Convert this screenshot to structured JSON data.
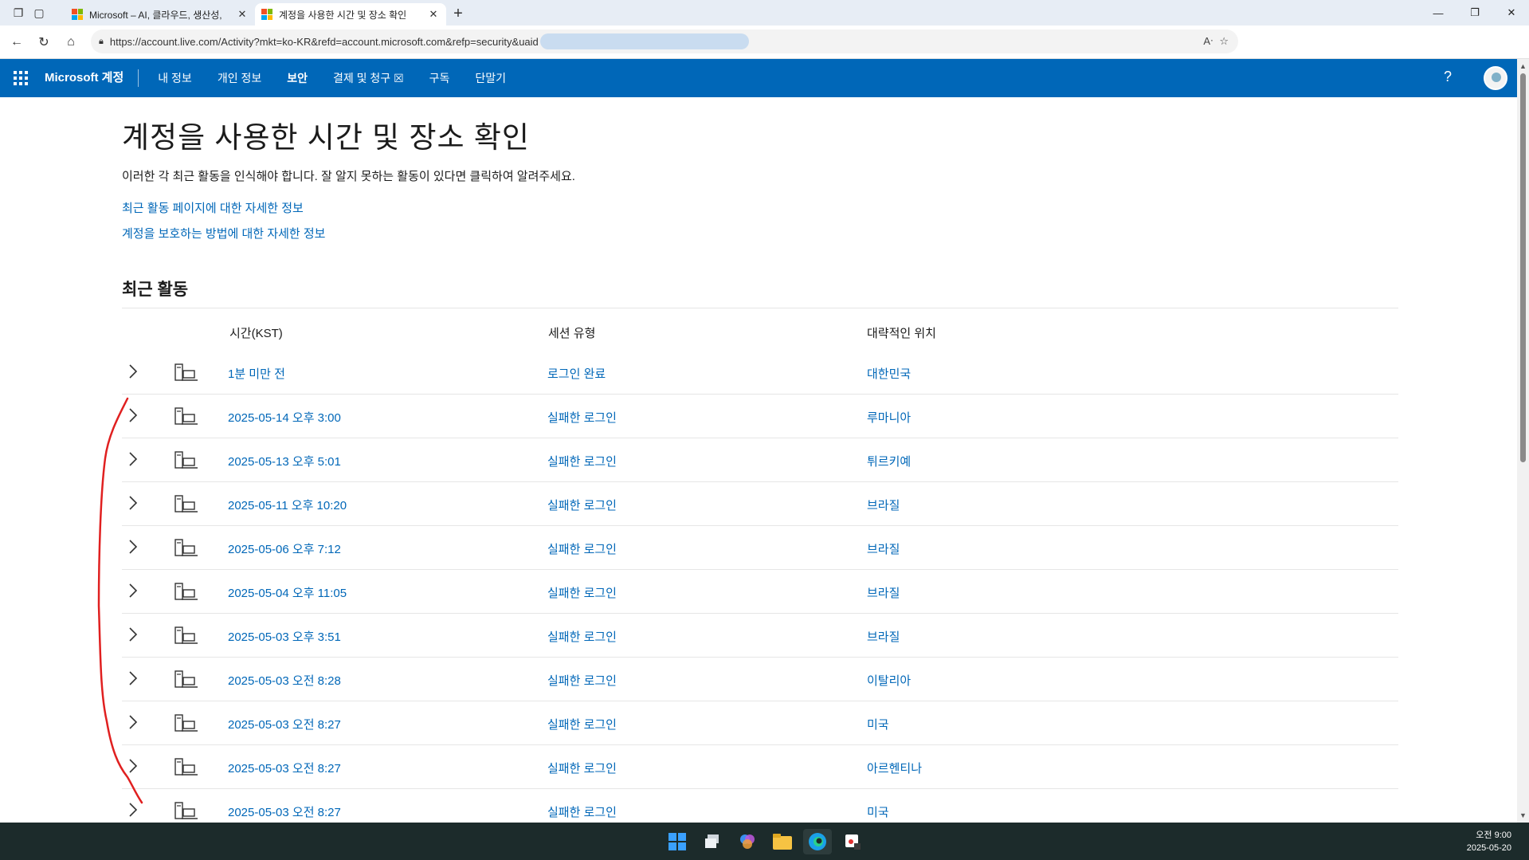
{
  "browser": {
    "tabs": [
      {
        "title": "Microsoft – AI, 클라우드, 생산성,",
        "active": false
      },
      {
        "title": "계정을 사용한 시간 및 장소 확인",
        "active": true
      }
    ],
    "url": "https://account.live.com/Activity?mkt=ko-KR&refd=account.microsoft.com&refp=security&uaid"
  },
  "msnav": {
    "brand": "Microsoft 계정",
    "items": [
      "내 정보",
      "개인 정보",
      "보안",
      "결제 및 청구 ☒",
      "구독",
      "단말기"
    ],
    "active_item": "보안"
  },
  "page": {
    "title": "계정을 사용한 시간 및 장소 확인",
    "description": "이러한 각 최근 활동을 인식해야 합니다. 잘 알지 못하는 활동이 있다면 클릭하여 알려주세요.",
    "links": [
      "최근 활동 페이지에 대한 자세한 정보",
      "계정을 보호하는 방법에 대한 자세한 정보"
    ],
    "section_title": "최근 활동"
  },
  "table": {
    "headers": {
      "time": "시간(KST)",
      "type": "세션 유형",
      "location": "대략적인 위치"
    },
    "rows": [
      {
        "time": "1분 미만 전",
        "type": "로그인 완료",
        "location": "대한민국"
      },
      {
        "time": "2025-05-14 오후 3:00",
        "type": "실패한 로그인",
        "location": "루마니아"
      },
      {
        "time": "2025-05-13 오후 5:01",
        "type": "실패한 로그인",
        "location": "튀르키예"
      },
      {
        "time": "2025-05-11 오후 10:20",
        "type": "실패한 로그인",
        "location": "브라질"
      },
      {
        "time": "2025-05-06 오후 7:12",
        "type": "실패한 로그인",
        "location": "브라질"
      },
      {
        "time": "2025-05-04 오후 11:05",
        "type": "실패한 로그인",
        "location": "브라질"
      },
      {
        "time": "2025-05-03 오후 3:51",
        "type": "실패한 로그인",
        "location": "브라질"
      },
      {
        "time": "2025-05-03 오전 8:28",
        "type": "실패한 로그인",
        "location": "이탈리아"
      },
      {
        "time": "2025-05-03 오전 8:27",
        "type": "실패한 로그인",
        "location": "미국"
      },
      {
        "time": "2025-05-03 오전 8:27",
        "type": "실패한 로그인",
        "location": "아르헨티나"
      },
      {
        "time": "2025-05-03 오전 8:27",
        "type": "실패한 로그인",
        "location": "미국"
      }
    ]
  },
  "taskbar": {
    "time": "오전 9:00",
    "date": "2025-05-20"
  },
  "colors": {
    "accent": "#0067b8",
    "annotation": "#e02020",
    "taskbar": "#1c2b2b"
  }
}
